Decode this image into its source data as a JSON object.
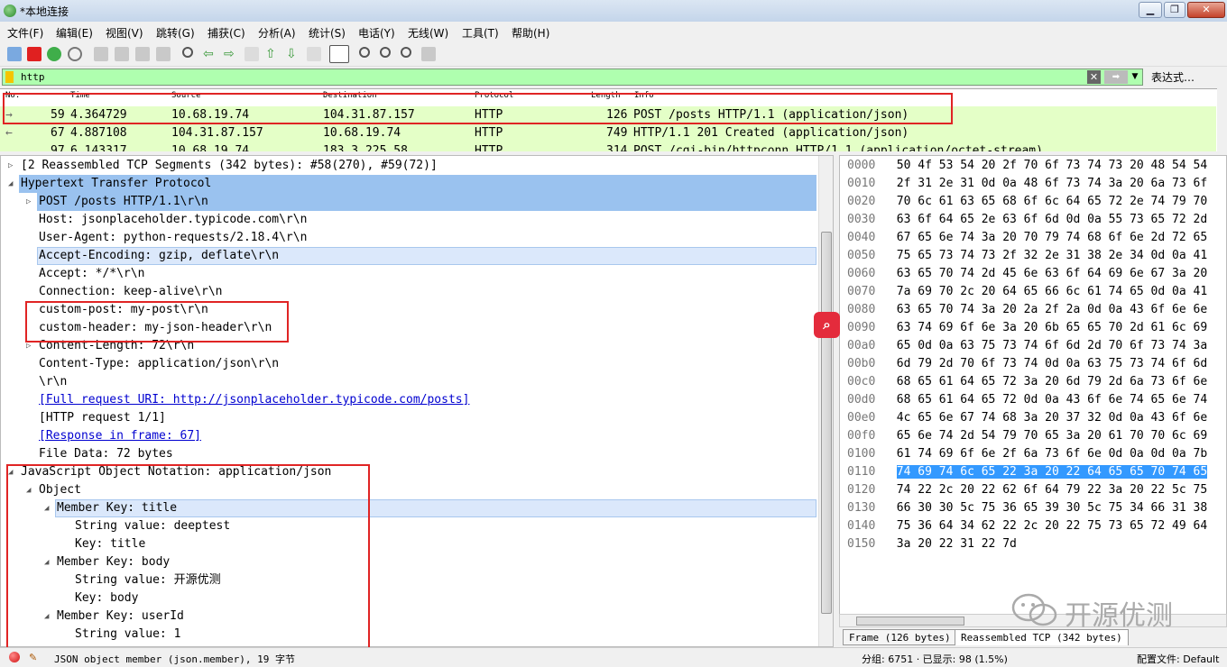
{
  "window": {
    "title": "*本地连接"
  },
  "menu": [
    "文件(F)",
    "编辑(E)",
    "视图(V)",
    "跳转(G)",
    "捕获(C)",
    "分析(A)",
    "统计(S)",
    "电话(Y)",
    "无线(W)",
    "工具(T)",
    "帮助(H)"
  ],
  "filter": {
    "value": "http",
    "expression_label": "表达式…"
  },
  "packet_list": {
    "headers": [
      "No.",
      "Time",
      "Source",
      "Destination",
      "Protocol",
      "Length",
      "Info"
    ],
    "rows": [
      {
        "no": "59",
        "time": "4.364729",
        "src": "10.68.19.74",
        "dst": "104.31.87.157",
        "proto": "HTTP",
        "len": "126",
        "info": "POST /posts HTTP/1.1  (application/json)"
      },
      {
        "no": "67",
        "time": "4.887108",
        "src": "104.31.87.157",
        "dst": "10.68.19.74",
        "proto": "HTTP",
        "len": "749",
        "info": "HTTP/1.1 201 Created  (application/json)"
      },
      {
        "no": "97",
        "time": "6.143317",
        "src": "10.68.19.74",
        "dst": "183.3.225.58",
        "proto": "HTTP",
        "len": "314",
        "info": "POST /cgi-bin/httpconn HTTP/1.1  (application/octet-stream)"
      }
    ]
  },
  "details": {
    "reassembled": "[2 Reassembled TCP Segments (342 bytes): #58(270), #59(72)]",
    "http": "Hypertext Transfer Protocol",
    "request_line": "POST /posts HTTP/1.1\\r\\n",
    "host": "Host: jsonplaceholder.typicode.com\\r\\n",
    "user_agent": "User-Agent: python-requests/2.18.4\\r\\n",
    "accept_encoding": "Accept-Encoding: gzip, deflate\\r\\n",
    "accept": "Accept: */*\\r\\n",
    "connection": "Connection: keep-alive\\r\\n",
    "custom_post": "custom-post: my-post\\r\\n",
    "custom_header": "custom-header: my-json-header\\r\\n",
    "content_length": "Content-Length: 72\\r\\n",
    "content_type": "Content-Type: application/json\\r\\n",
    "crlf": "\\r\\n",
    "full_uri": "[Full request URI: http://jsonplaceholder.typicode.com/posts]",
    "http_request": "[HTTP request 1/1]",
    "response_in": "[Response in frame: 67]",
    "file_data": "File Data: 72 bytes",
    "json": "JavaScript Object Notation: application/json",
    "object": "Object",
    "member_title": "Member Key: title",
    "str_deeptest": "String value: deeptest",
    "key_title": "Key: title",
    "member_body": "Member Key: body",
    "str_body": "String value: 开源优测",
    "key_body": "Key: body",
    "member_userid": "Member Key: userId",
    "str_userid": "String value: 1"
  },
  "hex": {
    "offsets": [
      "0000",
      "0010",
      "0020",
      "0030",
      "0040",
      "0050",
      "0060",
      "0070",
      "0080",
      "0090",
      "00a0",
      "00b0",
      "00c0",
      "00d0",
      "00e0",
      "00f0",
      "0100",
      "0110",
      "0120",
      "0130",
      "0140",
      "0150"
    ],
    "bytes": [
      "50 4f 53 54 20 2f 70 6f  73 74 73 20 48 54 54",
      "2f 31 2e 31 0d 0a 48 6f  73 74 3a 20 6a 73 6f",
      "70 6c 61 63 65 68 6f 6c  64 65 72 2e 74 79 70",
      "63 6f 64 65 2e 63 6f 6d  0d 0a 55 73 65 72 2d",
      "67 65 6e 74 3a 20 70 79  74 68 6f 6e 2d 72 65",
      "75 65 73 74 73 2f 32 2e  31 38 2e 34 0d 0a 41",
      "63 65 70 74 2d 45 6e 63  6f 64 69 6e 67 3a 20",
      "7a 69 70 2c 20 64 65 66  6c 61 74 65 0d 0a 41",
      "63 65 70 74 3a 20 2a 2f  2a 0d 0a 43 6f 6e 6e",
      "63 74 69 6f 6e 3a 20 6b  65 65 70 2d 61 6c 69",
      "65 0d 0a 63 75 73 74 6f  6d 2d 70 6f 73 74 3a",
      "6d 79 2d 70 6f 73 74 0d  0a 63 75 73 74 6f 6d",
      "68 65 61 64 65 72 3a 20  6d 79 2d 6a 73 6f 6e",
      "68 65 61 64 65 72 0d 0a  43 6f 6e 74 65 6e 74",
      "4c 65 6e 67 74 68 3a 20  37 32 0d 0a 43 6f 6e",
      "65 6e 74 2d 54 79 70 65  3a 20 61 70 70 6c 69",
      "61 74 69 6f 6e 2f 6a 73  6f 6e 0d 0a 0d 0a 7b",
      "74 69 74 6c 65 22 3a 20  22 64 65 65 70 74 65",
      "74 22 2c 20 22 62 6f 64  79 22 3a 20 22 5c 75",
      "66 30 30 5c 75 36 65 39  30 5c 75 34 66 31 38",
      "75 36 64 34 62 22 2c 20  22 75 73 65 72 49 64",
      "3a 20 22 31 22 7d"
    ],
    "tabs": [
      "Frame (126 bytes)",
      "Reassembled TCP (342 bytes)"
    ]
  },
  "status": {
    "field": "JSON object member (json.member), 19 字节",
    "packets": "分组: 6751 · 已显示: 98 (1.5%)",
    "profile": "配置文件: Default"
  },
  "watermark": "开源优测"
}
